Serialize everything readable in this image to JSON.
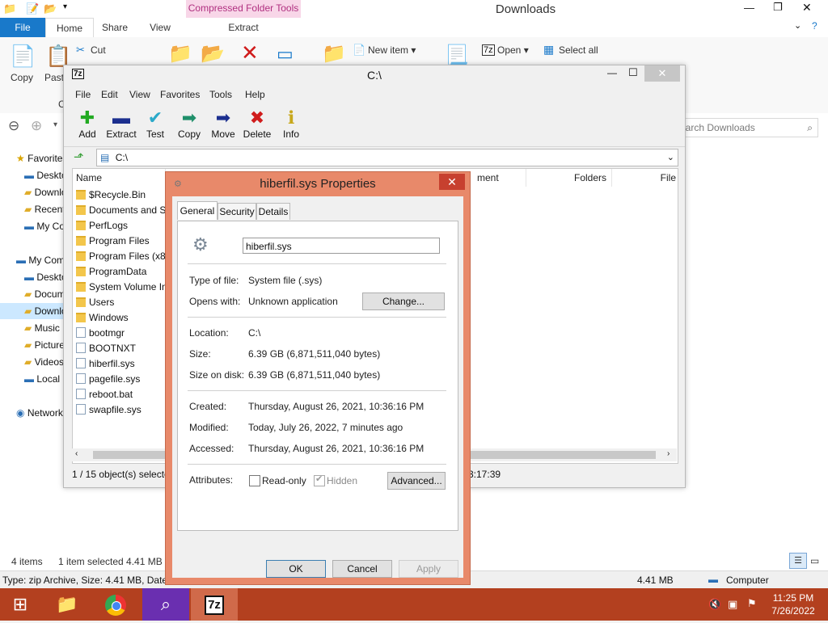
{
  "explorer": {
    "title": "Downloads",
    "contextual_tab_header": "Compressed Folder Tools",
    "ribbon_tabs": [
      "File",
      "Home",
      "Share",
      "View",
      "Extract"
    ],
    "ribbon": {
      "copy_label": "Copy",
      "paste_label": "Paste",
      "cut_label": "Cut",
      "new_item_label": "New item ▾",
      "open_label": "Open ▾",
      "select_all_label": "Select all",
      "partial_label": "C"
    },
    "search_placeholder": "Search Downloads",
    "tree": [
      "Favorites",
      "Desktop",
      "Downloads",
      "Recent places",
      "My Computer",
      "My Computer",
      "Desktop",
      "Documents",
      "Downloads",
      "Music",
      "Pictures",
      "Videos",
      "Local Disk",
      "Network"
    ],
    "column_right": "File",
    "status_left": "4 items",
    "status_selected": "1 item selected  4.41 MB",
    "detail_left": "Type: zip Archive, Size: 4.41 MB, Date m",
    "detail_size": "4.41 MB",
    "detail_location": "Computer"
  },
  "sevenzip": {
    "title": "C:\\",
    "menu": [
      "File",
      "Edit",
      "View",
      "Favorites",
      "Tools",
      "Help"
    ],
    "toolbar": [
      {
        "label": "Add",
        "icon": "plus-icon",
        "color": "#22aa22"
      },
      {
        "label": "Extract",
        "icon": "minus-icon",
        "color": "#1c2f8f"
      },
      {
        "label": "Test",
        "icon": "check-icon",
        "color": "#2aa9c9"
      },
      {
        "label": "Copy",
        "icon": "arrow-right-icon",
        "color": "#1f8f6a"
      },
      {
        "label": "Move",
        "icon": "arrow-right-icon",
        "color": "#1c2f8f"
      },
      {
        "label": "Delete",
        "icon": "x-icon",
        "color": "#d01c1c"
      },
      {
        "label": "Info",
        "icon": "info-icon",
        "color": "#c8a81c"
      }
    ],
    "address": "C:\\",
    "columns": {
      "name": "Name",
      "comment": "ment",
      "folders": "Folders",
      "files": "File"
    },
    "files": [
      {
        "name": "$Recycle.Bin",
        "type": "folder"
      },
      {
        "name": "Documents and S",
        "type": "folder"
      },
      {
        "name": "PerfLogs",
        "type": "folder"
      },
      {
        "name": "Program Files",
        "type": "folder"
      },
      {
        "name": "Program Files (x86",
        "type": "folder"
      },
      {
        "name": "ProgramData",
        "type": "folder"
      },
      {
        "name": "System Volume In",
        "type": "folder"
      },
      {
        "name": "Users",
        "type": "folder"
      },
      {
        "name": "Windows",
        "type": "folder"
      },
      {
        "name": "bootmgr",
        "type": "file"
      },
      {
        "name": "BOOTNXT",
        "type": "file"
      },
      {
        "name": "hiberfil.sys",
        "type": "file"
      },
      {
        "name": "pagefile.sys",
        "type": "file"
      },
      {
        "name": "reboot.bat",
        "type": "file"
      },
      {
        "name": "swapfile.sys",
        "type": "file"
      }
    ],
    "status_left": "1 / 15 object(s) selecte",
    "status_right": "3:17:39"
  },
  "props": {
    "title": "hiberfil.sys Properties",
    "tabs": [
      "General",
      "Security",
      "Details"
    ],
    "filename": "hiberfil.sys",
    "type_label": "Type of file:",
    "type_value": "System file (.sys)",
    "opens_label": "Opens with:",
    "opens_value": "Unknown application",
    "change_button": "Change...",
    "location_label": "Location:",
    "location_value": "C:\\",
    "size_label": "Size:",
    "size_value": "6.39 GB (6,871,511,040 bytes)",
    "size_disk_label": "Size on disk:",
    "size_disk_value": "6.39 GB (6,871,511,040 bytes)",
    "created_label": "Created:",
    "created_value": "Thursday, August 26, 2021, 10:36:16 PM",
    "modified_label": "Modified:",
    "modified_value": "Today, July 26, 2022, 7 minutes ago",
    "accessed_label": "Accessed:",
    "accessed_value": "Thursday, August 26, 2021, 10:36:16 PM",
    "attributes_label": "Attributes:",
    "readonly_label": "Read-only",
    "hidden_label": "Hidden",
    "advanced_button": "Advanced...",
    "ok_button": "OK",
    "cancel_button": "Cancel",
    "apply_button": "Apply"
  },
  "taskbar": {
    "time": "11:25 PM",
    "date": "7/26/2022"
  },
  "colors": {
    "accent_blue": "#1979ca",
    "taskbar": "#b3401f",
    "dialog_frame": "#e8896a"
  }
}
